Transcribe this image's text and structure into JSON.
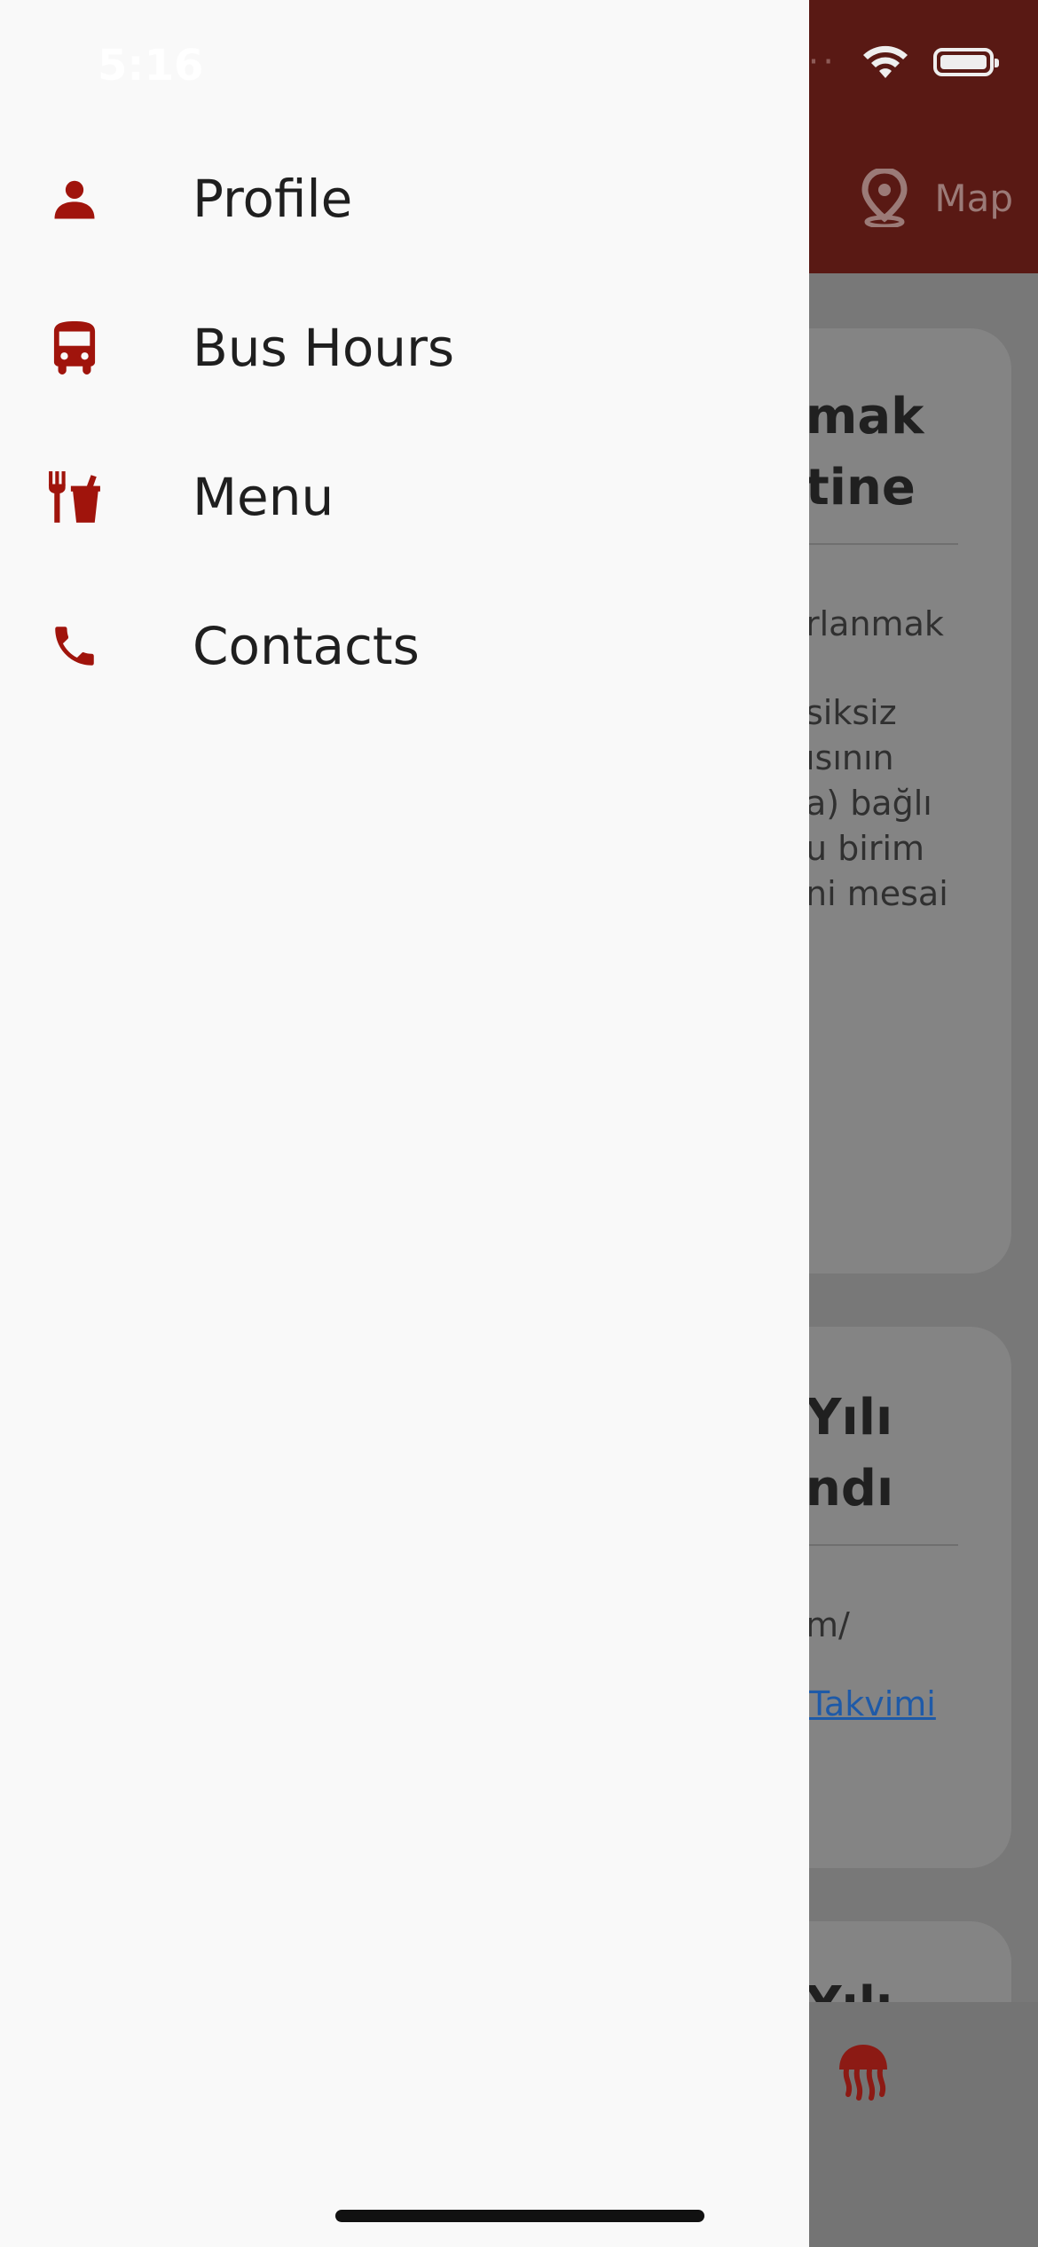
{
  "status_bar": {
    "time": "5:16"
  },
  "header": {
    "map_label": "Map"
  },
  "drawer": {
    "items": [
      {
        "label": "Profile",
        "icon": "person-icon"
      },
      {
        "label": "Bus Hours",
        "icon": "bus-icon"
      },
      {
        "label": "Menu",
        "icon": "restaurant-icon"
      },
      {
        "label": "Contacts",
        "icon": "phone-icon"
      }
    ]
  },
  "background_cards": {
    "card1": {
      "title_lines": [
        "mak",
        "tine"
      ],
      "body_lines": [
        "rlanmak",
        "",
        "siksiz",
        "ısının",
        "a) bağlı",
        "u birim",
        "ni mesai"
      ]
    },
    "card2": {
      "title_lines": [
        "Yılı",
        "ndı"
      ],
      "body_line": "m/",
      "link": "Takvimi"
    },
    "card3": {
      "title_partial": "Yılı"
    }
  },
  "colors": {
    "accent": "#a0140c",
    "header_bg": "#591914",
    "drawer_bg": "#f9f9f9"
  }
}
